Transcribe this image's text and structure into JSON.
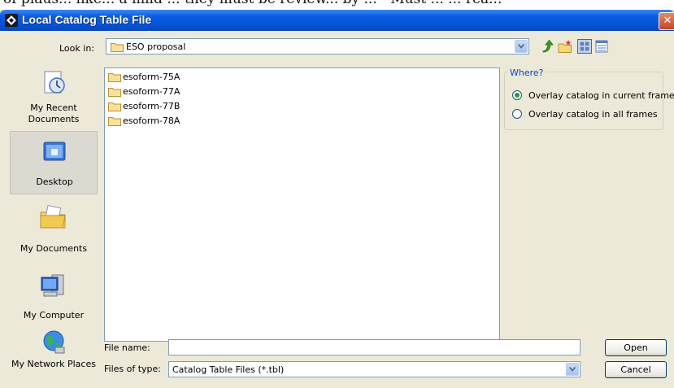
{
  "above_text": "of plaus... like... a mild ... they must be review... by ... - Must ... ... rea...",
  "window": {
    "title": "Local Catalog Table File",
    "close_glyph": "✕"
  },
  "look_in": {
    "label": "Look in:",
    "value": "ESO proposal"
  },
  "places": [
    {
      "label": "My Recent Documents",
      "icon": "recent-documents-icon"
    },
    {
      "label": "Desktop",
      "icon": "desktop-icon",
      "selected": true
    },
    {
      "label": "My Documents",
      "icon": "my-documents-icon"
    },
    {
      "label": "My Computer",
      "icon": "my-computer-icon"
    },
    {
      "label": "My Network Places",
      "icon": "network-places-icon"
    }
  ],
  "files": [
    "esoform-75A",
    "esoform-77A",
    "esoform-77B",
    "esoform-78A"
  ],
  "where": {
    "legend": "Where?",
    "options": [
      {
        "label": "Overlay catalog in current frame",
        "selected": true
      },
      {
        "label": "Overlay catalog in all frames",
        "selected": false
      }
    ]
  },
  "file_name": {
    "label": "File name:",
    "value": ""
  },
  "file_type": {
    "label": "Files of type:",
    "value": "Catalog Table Files (*.tbl)"
  },
  "buttons": {
    "open": "Open",
    "cancel": "Cancel"
  },
  "colors": {
    "titlebar": "#0554d8",
    "panel": "#ece9d8",
    "accent": "#0046d5",
    "radio_dot": "#21a121"
  }
}
